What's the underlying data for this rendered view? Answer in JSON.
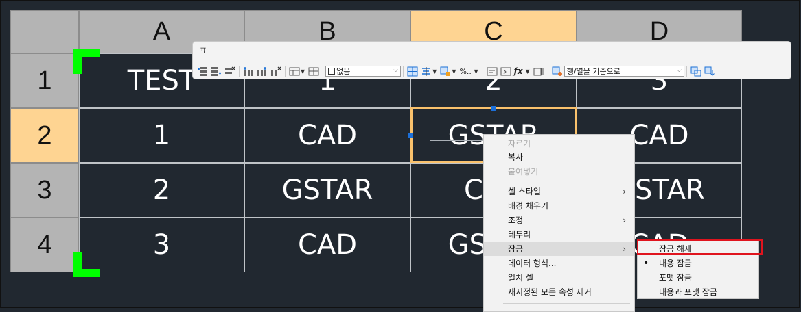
{
  "columns": [
    "A",
    "B",
    "C",
    "D"
  ],
  "rows": [
    "1",
    "2",
    "3",
    "4"
  ],
  "selected_column": "C",
  "selected_row": "2",
  "cells": [
    [
      "TEST",
      "1",
      "2",
      "3"
    ],
    [
      "1",
      "CAD",
      "GSTAR",
      "CAD"
    ],
    [
      "2",
      "GSTAR",
      "CAD",
      "GSTAR"
    ],
    [
      "3",
      "CAD",
      "GSTAR",
      "CAD"
    ]
  ],
  "toolbar": {
    "title": "표",
    "cell_border_value": "없음",
    "match_dropdown_value": "행/열을 기준으로",
    "number_format_label": "%..",
    "icons": [
      "insert-row-above-icon",
      "insert-row-below-icon",
      "delete-row-icon",
      "insert-column-left-icon",
      "insert-column-right-icon",
      "delete-column-icon",
      "merge-cells-icon",
      "unmerge-cells-icon",
      "cell-border-icon",
      "alignment-icon",
      "cell-lock-icon",
      "data-format-icon",
      "insert-block-icon",
      "insert-field-icon",
      "formula-icon",
      "manage-cell-content-icon",
      "match-cell-icon",
      "link-cell-icon",
      "download-changes-icon"
    ]
  },
  "context_menu": {
    "items": [
      {
        "label": "자르기",
        "disabled": true,
        "submenu": false
      },
      {
        "label": "복사",
        "disabled": false,
        "submenu": false
      },
      {
        "label": "붙여넣기",
        "disabled": true,
        "submenu": false
      },
      {
        "label": "셀 스타일",
        "disabled": false,
        "submenu": true
      },
      {
        "label": "배경 채우기",
        "disabled": false,
        "submenu": false
      },
      {
        "label": "조정",
        "disabled": false,
        "submenu": true
      },
      {
        "label": "테두리",
        "disabled": false,
        "submenu": false
      },
      {
        "label": "잠금",
        "disabled": false,
        "submenu": true,
        "highlighted": true
      },
      {
        "label": "데이터 형식...",
        "disabled": false,
        "submenu": false
      },
      {
        "label": "일치 셀",
        "disabled": false,
        "submenu": false
      },
      {
        "label": "재지정된 모든 속성 제거",
        "disabled": false,
        "submenu": false
      }
    ],
    "submenu_arrow": "›"
  },
  "lock_submenu": {
    "items": [
      {
        "label": "잠금 해제",
        "checked": false,
        "highlighted": true
      },
      {
        "label": "내용 잠금",
        "checked": true
      },
      {
        "label": "포맷 잠금",
        "checked": false
      },
      {
        "label": "내용과 포맷 잠금",
        "checked": false
      }
    ],
    "check_mark": "•"
  },
  "colors": {
    "canvas_bg": "#212830",
    "header_bg": "#b4b4b4",
    "header_selected_bg": "#fed492",
    "selection_border": "#f9c16c",
    "corner_marker": "#00ff00",
    "grip": "#1c6fd8",
    "highlight_box": "#e0141e"
  }
}
